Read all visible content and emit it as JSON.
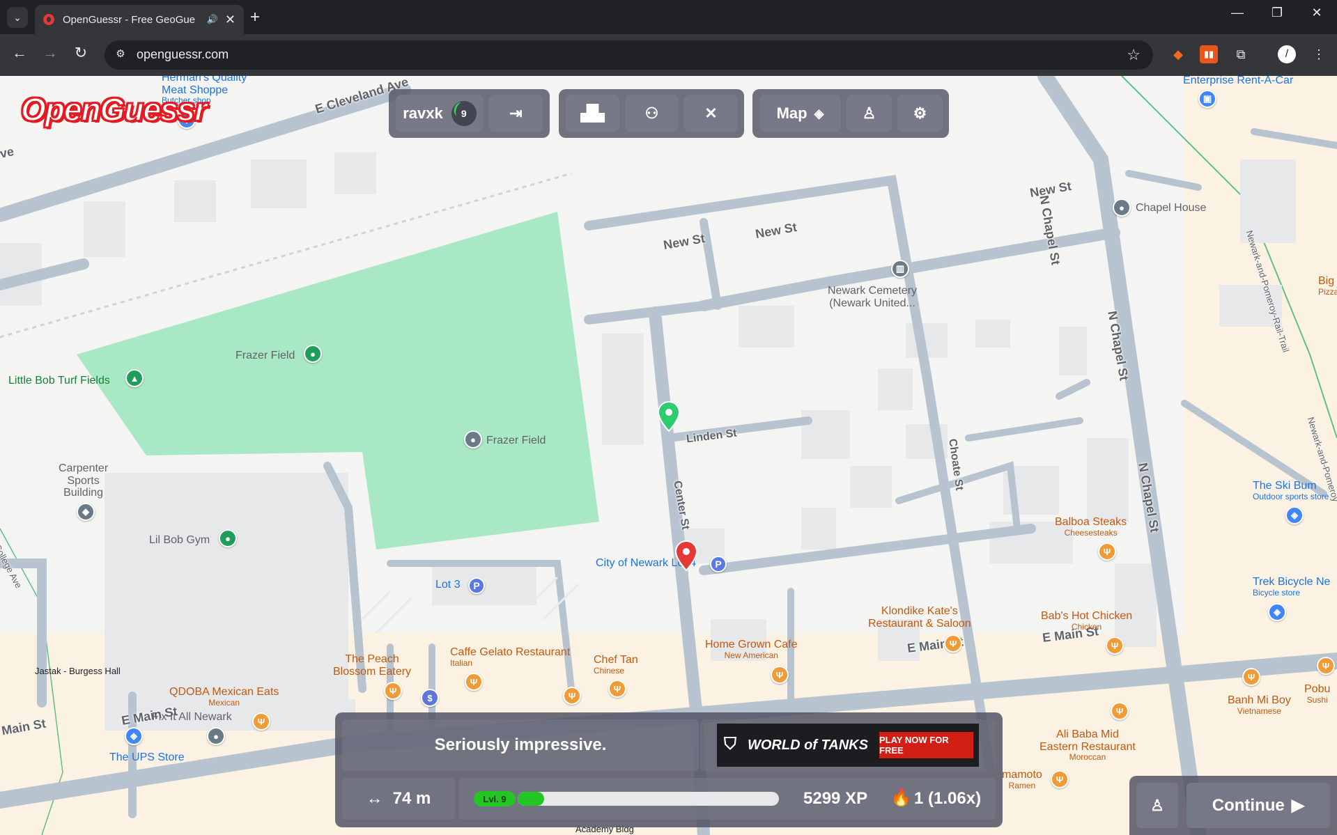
{
  "browser": {
    "tab_title": "OpenGuessr - Free GeoGue",
    "url": "openguessr.com"
  },
  "header": {
    "username": "ravxk",
    "level": "9",
    "map_label": "Map"
  },
  "map": {
    "labels": {
      "hermans": "Herman's Quality",
      "hermans2": "Meat Shoppe",
      "hermans_sub": "Butcher shop",
      "enterprise": "Enterprise Rent-A-Car",
      "chapel_house": "Chapel House",
      "big": "Big",
      "big_sub": "Pizza",
      "newark_cemetery": "Newark Cemetery",
      "newark_cemetery2": "(Newark United...",
      "frazer_field_top": "Frazer Field",
      "frazer_field_mid": "Frazer Field",
      "little_bob": "Little Bob Turf Fields",
      "carpenter": "Carpenter",
      "carpenter2": "Sports",
      "carpenter3": "Building",
      "lil_bob": "Lil Bob Gym",
      "lot3": "Lot 3",
      "city_of_newark": "City of Newark Lot 4",
      "ski_bum": "The Ski Bum",
      "ski_bum_sub": "Outdoor sports store",
      "balboa": "Balboa Steaks",
      "balboa_sub": "Cheesesteaks",
      "klondike": "Klondike Kate's",
      "klondike2": "Restaurant & Saloon",
      "babs": "Bab's Hot Chicken",
      "babs_sub": "Chicken",
      "trek": "Trek Bicycle Ne",
      "trek_sub": "Bicycle store",
      "home_grown": "Home Grown Cafe",
      "home_grown_sub": "New American",
      "peach": "The Peach",
      "peach2": "Blossom Eatery",
      "caffe": "Caffe Gelato Restaurant",
      "caffe_sub": "Italian",
      "chef_tan": "Chef Tan",
      "chef_tan_sub": "Chinese",
      "jastak": "Jastak - Burgess Hall",
      "qdoba": "QDOBA Mexican Eats",
      "qdoba_sub": "Mexican",
      "fixit": "Fix It All Newark",
      "ups": "The UPS Store",
      "banh": "Banh Mi Boy",
      "banh_sub": "Vietnamese",
      "pobu": "Pobu",
      "pobu_sub": "Sushi",
      "ali_baba": "Ali Baba Mid",
      "ali_baba2": "Eastern Restaurant",
      "ali_baba_sub": "Moroccan",
      "mamoto": "mamoto",
      "mamoto_sub": "Ramen",
      "academy": "Academy Bldg"
    },
    "streets": {
      "e_cleveland": "E Cleveland Ave",
      "ave_left": "ve",
      "new_st_1": "New St",
      "new_st_2": "New St",
      "new_st_3": "New St",
      "n_chapel_1": "N Chapel St",
      "n_chapel_2": "N Chapel St",
      "n_chapel_3": "N Chapel St",
      "newark_pomeroy": "Newark-and-Pomeroy-Rail-Trail",
      "newark_pomeroy2": "Newark-and-Pomeroy",
      "linden": "Linden St",
      "center": "Center St",
      "choate": "Choate St",
      "e_main_1": "E Main St",
      "e_main_2": "E Main St",
      "e_main_3": "E Main St",
      "main_left": "Main St",
      "college": "College Ave"
    }
  },
  "result": {
    "message": "Seriously impressive.",
    "ad_brand": "WORLD of TANKS",
    "ad_cta": "PLAY NOW FOR FREE",
    "distance": "74 m",
    "level_tag": "Lvl. 9",
    "xp_progress": 0.1,
    "xp": "5299 XP",
    "streak": "1 (1.06x)",
    "continue": "Continue"
  }
}
